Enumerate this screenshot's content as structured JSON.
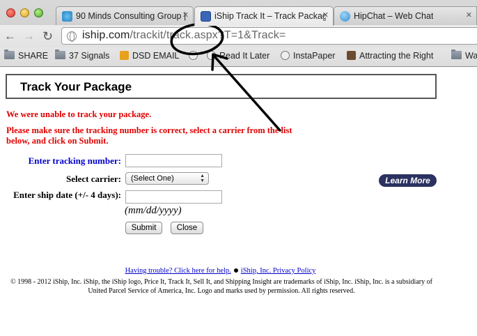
{
  "browser": {
    "tabs": [
      {
        "label": "90 Minds Consulting Group |",
        "active": false
      },
      {
        "label": "iShip Track It – Track Packag",
        "active": true
      },
      {
        "label": "HipChat – Web Chat",
        "active": false
      }
    ],
    "url_host": "iship.com",
    "url_rest": "/trackit/track.aspx?T=1&Track=",
    "bookmarks": [
      "SHARE",
      "37 Signals",
      "DSD EMAIL",
      "Read It Later",
      "InstaPaper",
      "Attracting the Right",
      "Wa"
    ]
  },
  "page": {
    "title": "Track Your Package",
    "error_line1": "We were unable to track your package.",
    "error_line2": "Please make sure the tracking number is correct, select a carrier from the list below, and click on Submit.",
    "form": {
      "tracking_label": "Enter tracking number:",
      "tracking_value": "",
      "carrier_label": "Select carrier:",
      "carrier_selected": "(Select One)",
      "shipdate_label": "Enter ship date (+/- 4 days):",
      "shipdate_value": "",
      "date_hint": "(mm/dd/yyyy)",
      "submit_label": "Submit",
      "close_label": "Close"
    },
    "learn_more": "Learn More",
    "footer": {
      "help_link": "Having trouble? Click here for help.",
      "privacy_link": "iShip, Inc. Privacy Policy",
      "copyright": "© 1998 - 2012 iShip, Inc. iShip, the iShip logo, Price It, Track It, Sell It, and Shipping Insight are trademarks of iShip, Inc. iShip, Inc. is a subsidiary of United Parcel Service of America, Inc. Logo and marks used by permission. All rights reserved."
    }
  },
  "colors": {
    "error_red": "#e00000",
    "label_blue": "#0000cc",
    "learn_more_bg": "#2b3160",
    "annotation": "#000000"
  },
  "icons": [
    "close-window-icon",
    "minimize-window-icon",
    "zoom-window-icon",
    "back-arrow-icon",
    "forward-arrow-icon",
    "reload-icon",
    "globe-icon",
    "folder-icon",
    "tab-close-icon"
  ]
}
